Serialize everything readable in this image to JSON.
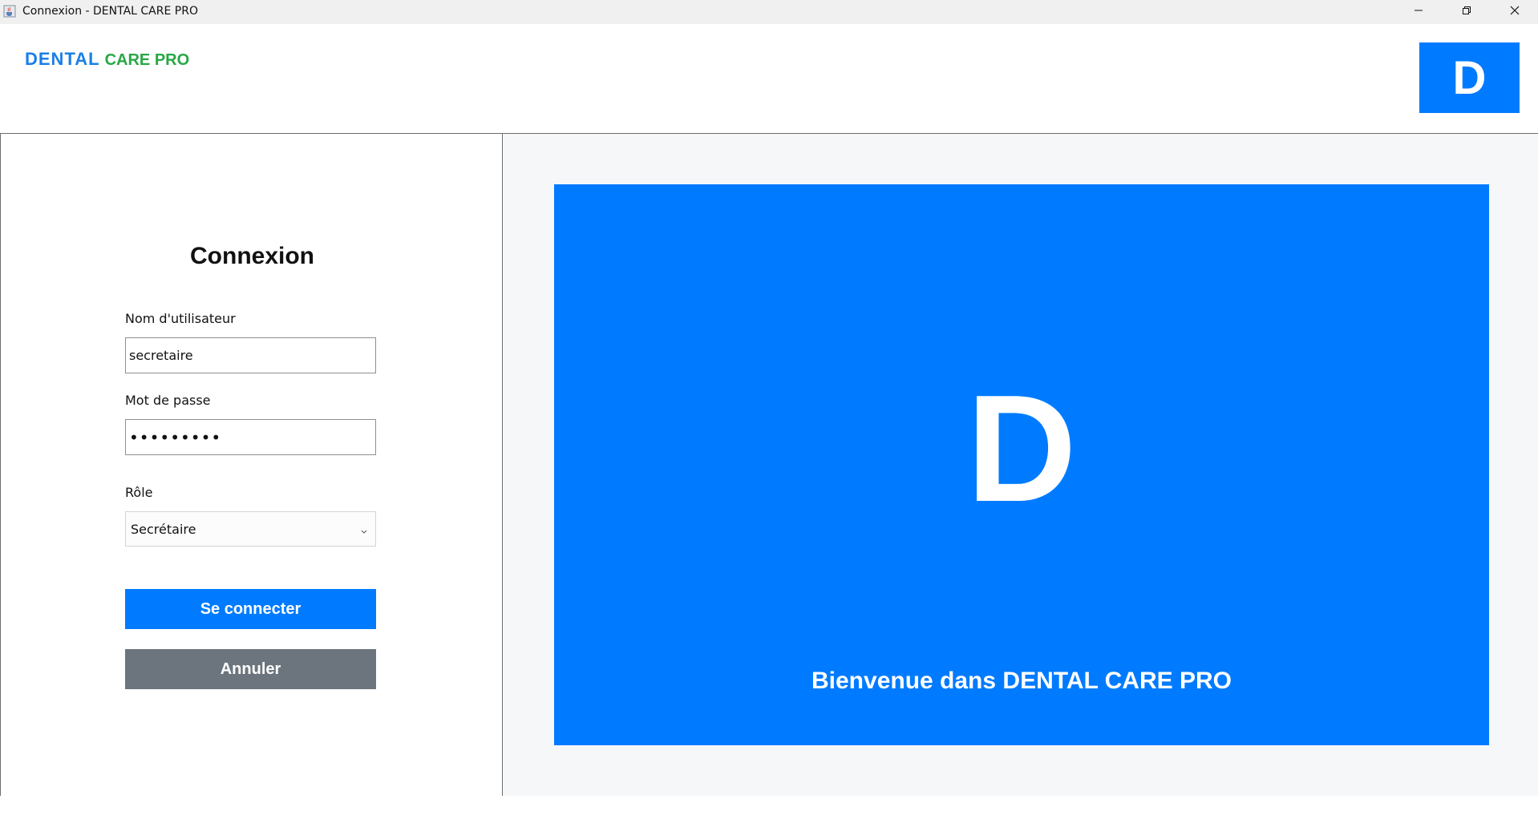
{
  "window": {
    "title": "Connexion - DENTAL CARE PRO"
  },
  "header": {
    "logo_part1": "DENTAL",
    "logo_part2": "CARE PRO",
    "badge_letter": "D"
  },
  "login": {
    "title": "Connexion",
    "username_label": "Nom d'utilisateur",
    "username_value": "secretaire",
    "password_label": "Mot de passe",
    "password_value": "•••••••••",
    "role_label": "Rôle",
    "role_value": "Secrétaire",
    "connect_label": "Se connecter",
    "cancel_label": "Annuler"
  },
  "welcome": {
    "letter": "D",
    "message": "Bienvenue dans DENTAL CARE PRO"
  },
  "colors": {
    "primary": "#007bff",
    "logo_blue": "#1a7fe6",
    "logo_green": "#28a745",
    "secondary": "#6c757d",
    "panel_bg": "#f6f7f9"
  },
  "icons": {
    "app": "java-cup-icon",
    "minimize": "minimize-icon",
    "maximize": "restore-icon",
    "close": "close-icon",
    "dropdown": "chevron-down-icon"
  }
}
